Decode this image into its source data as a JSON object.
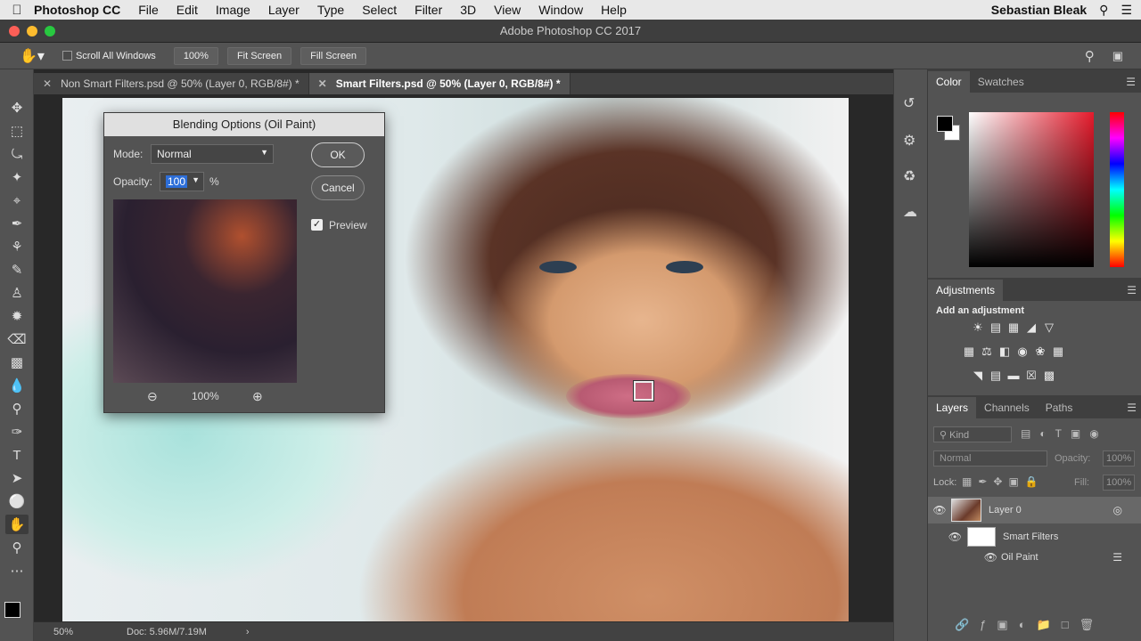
{
  "menubar": {
    "app_name": "Photoshop CC",
    "items": [
      "File",
      "Edit",
      "Image",
      "Layer",
      "Type",
      "Select",
      "Filter",
      "3D",
      "View",
      "Window",
      "Help"
    ],
    "user": "Sebastian Bleak"
  },
  "window": {
    "title": "Adobe Photoshop CC 2017"
  },
  "options_bar": {
    "scroll_all_label": "Scroll All Windows",
    "zoom_btn": "100%",
    "fit_btn": "Fit Screen",
    "fill_btn": "Fill Screen"
  },
  "doc_tabs": [
    {
      "label": "Non Smart Filters.psd @ 50% (Layer 0, RGB/8#) *",
      "active": false
    },
    {
      "label": "Smart Filters.psd @ 50% (Layer 0, RGB/8#) *",
      "active": true
    }
  ],
  "dialog": {
    "title": "Blending Options (Oil Paint)",
    "mode_label": "Mode:",
    "mode_value": "Normal",
    "opacity_label": "Opacity:",
    "opacity_value": "100",
    "opacity_unit": "%",
    "ok": "OK",
    "cancel": "Cancel",
    "preview_label": "Preview",
    "preview_checked": true,
    "zoom_value": "100%"
  },
  "panels": {
    "color_tabs": [
      "Color",
      "Swatches"
    ],
    "adjustments_tab": "Adjustments",
    "adjustments_hint": "Add an adjustment",
    "layers_tabs": [
      "Layers",
      "Channels",
      "Paths"
    ],
    "filter_placeholder": "Kind",
    "blend_mode": "Normal",
    "opacity_label": "Opacity:",
    "opacity_value": "100%",
    "lock_label": "Lock:",
    "fill_label": "Fill:",
    "fill_value": "100%",
    "layers": [
      {
        "name": "Layer 0"
      },
      {
        "name": "Smart Filters"
      },
      {
        "name": "Oil Paint"
      }
    ]
  },
  "status": {
    "zoom": "50%",
    "doc": "Doc: 5.96M/7.19M"
  }
}
